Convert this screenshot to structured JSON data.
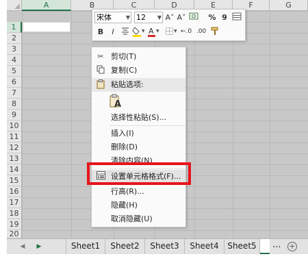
{
  "columns": [
    "A",
    "B",
    "C",
    "D",
    "E",
    "F",
    "G"
  ],
  "rows": [
    "1",
    "2",
    "3",
    "4",
    "5",
    "6",
    "7",
    "8",
    "9",
    "10",
    "11",
    "12",
    "13",
    "14",
    "15",
    "16",
    "17",
    "18",
    "19",
    "20"
  ],
  "mini_toolbar": {
    "font_name": "宋体",
    "font_size": "12",
    "grow_font": "A˄",
    "shrink_font": "A˅",
    "percent": "%",
    "comma": "9",
    "bold": "B",
    "italic": "I",
    "font_color_label": "A",
    "decimal_increase": "←.0",
    "decimal_decrease": ".00"
  },
  "context_menu": {
    "cut": "剪切(T)",
    "copy": "复制(C)",
    "paste_options": "粘贴选项:",
    "paste_glyph": "A",
    "paste_special": "选择性粘贴(S)...",
    "insert": "插入(I)",
    "delete": "删除(D)",
    "clear": "清除内容(N)",
    "format_cells": "设置单元格格式(F)...",
    "row_height": "行高(R)...",
    "hide": "隐藏(H)",
    "unhide": "取消隐藏(U)"
  },
  "sheets": [
    "Sheet1",
    "Sheet2",
    "Sheet3",
    "Sheet4",
    "Sheet5"
  ],
  "more_sheets": "...",
  "add_sheet": "+",
  "colors": {
    "highlight_border": "#e8141b",
    "accent_green": "#217346",
    "fill_yellow": "#ffd800",
    "font_red": "#d42a2a"
  }
}
